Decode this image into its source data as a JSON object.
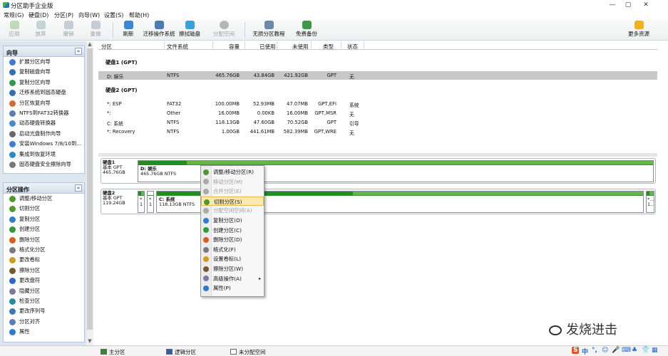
{
  "app": {
    "title": "分区助手企业版"
  },
  "window": {
    "min": "—",
    "max": "▢",
    "close": "✕"
  },
  "menu": [
    "常规(G)",
    "硬盘(D)",
    "分区(P)",
    "向导(W)",
    "设置(S)",
    "帮助(H)"
  ],
  "toolbar": {
    "apply": "应用",
    "discard": "放弃",
    "undo": "撤销",
    "redo": "重做",
    "refresh": "刷新",
    "migrate": "迁移操作系统",
    "wipe": "擦拭磁盘",
    "allocate": "分配空间",
    "lossless": "无损分区教程",
    "backup": "免费备份",
    "more": "更多资源"
  },
  "wizard": {
    "title": "向导",
    "items": [
      "扩展分区向导",
      "复制磁盘向导",
      "复制分区向导",
      "迁移系统到固态硬盘",
      "分区恢复向导",
      "NTFS到FAT32转换器",
      "动态硬盘转换器",
      "启动光盘制作向导",
      "安装Windows 7/8/10到...",
      "集成到恢复环境",
      "固态硬盘安全擦除向导"
    ],
    "colors": [
      "#3a7bd5",
      "#2f6fb5",
      "#2e9a46",
      "#2f6fb5",
      "#d86a2e",
      "#5a7fb6",
      "#3e8ed0",
      "#6a6a6a",
      "#3b7ed8",
      "#2b8ad0",
      "#777777"
    ]
  },
  "ops": {
    "title": "分区操作",
    "items": [
      "调整/移动分区",
      "切割分区",
      "复制分区",
      "创建分区",
      "删除分区",
      "格式化分区",
      "更改卷标",
      "擦除分区",
      "更改盘符",
      "隐藏分区",
      "检查分区",
      "更改序列号",
      "分区对齐",
      "属性"
    ],
    "colors": [
      "#4c9a2a",
      "#4c9a2a",
      "#2e7fd0",
      "#2f9a3c",
      "#e05a1c",
      "#7a7a7a",
      "#d69a1a",
      "#7a5a2a",
      "#2a6ad0",
      "#7a7aa0",
      "#2a8a9a",
      "#3a7ab0",
      "#5a7fb6",
      "#2a7ad0"
    ]
  },
  "table": {
    "headers": [
      "分区",
      "文件系统",
      "容量",
      "已使用",
      "未使用",
      "类型",
      "状态"
    ],
    "disk1": "硬盘1 (GPT)",
    "disk1_rows": [
      [
        "D: 娱乐",
        "NTFS",
        "465.76GB",
        "43.84GB",
        "421.92GB",
        "GPT",
        "无"
      ]
    ],
    "disk2": "硬盘2 (GPT)",
    "disk2_rows": [
      [
        "*: ESP",
        "FAT32",
        "100.00MB",
        "52.93MB",
        "47.07MB",
        "GPT,EFI",
        "系统"
      ],
      [
        "*:",
        "Other",
        "16.00MB",
        "0.00KB",
        "16.00MB",
        "GPT,MSR",
        "无"
      ],
      [
        "C: 系统",
        "NTFS",
        "118.13GB",
        "47.60GB",
        "70.52GB",
        "GPT",
        "引导"
      ],
      [
        "*: Recovery",
        "NTFS",
        "1.00GB",
        "441.61MB",
        "582.39MB",
        "GPT,WRE",
        "无"
      ]
    ]
  },
  "map": {
    "disk1": {
      "name": "硬盘1",
      "type": "基本 GPT",
      "size": "465.76GB",
      "part_label": "D: 娱乐",
      "part_info": "465.76GB NTFS",
      "used_fraction": 0.094
    },
    "disk2": {
      "name": "硬盘2",
      "type": "基本 GPT",
      "size": "119.24GB",
      "p1_a": "*",
      "p1_b": "1",
      "p2_a": "*",
      "p2_b": "1",
      "main_label": "C: 系统",
      "main_info": "118.13GB NTFS",
      "main_used_fraction": 0.403,
      "last_a": "*...",
      "last_b": "1..."
    }
  },
  "context": {
    "items": [
      "调整/移动分区(R)",
      "移动分区(M)",
      "合并分区(E)",
      "切割分区(S)",
      "分配空闲空间(A)",
      "复制分区(O)",
      "创建分区(C)",
      "删除分区(D)",
      "格式化(F)",
      "设置卷标(L)",
      "擦除分区(W)",
      "高级操作(A)",
      "属性(P)"
    ],
    "submenu_arrow": "▸"
  },
  "statusbar": {
    "primary": "主分区",
    "logical": "逻辑分区",
    "unallocated": "未分配空间",
    "primary_color": "#2e8b2e",
    "logical_color": "#2b5fb5",
    "unallocated_color": "#ffffff"
  },
  "tray": [
    "S",
    "中",
    "°,",
    "☺",
    "🎤",
    "⌨",
    "♣",
    "👕",
    "▦"
  ],
  "watermark": "发烧进击",
  "scroll": {
    "up": "▲",
    "down": "▼",
    "collapse": "«"
  }
}
